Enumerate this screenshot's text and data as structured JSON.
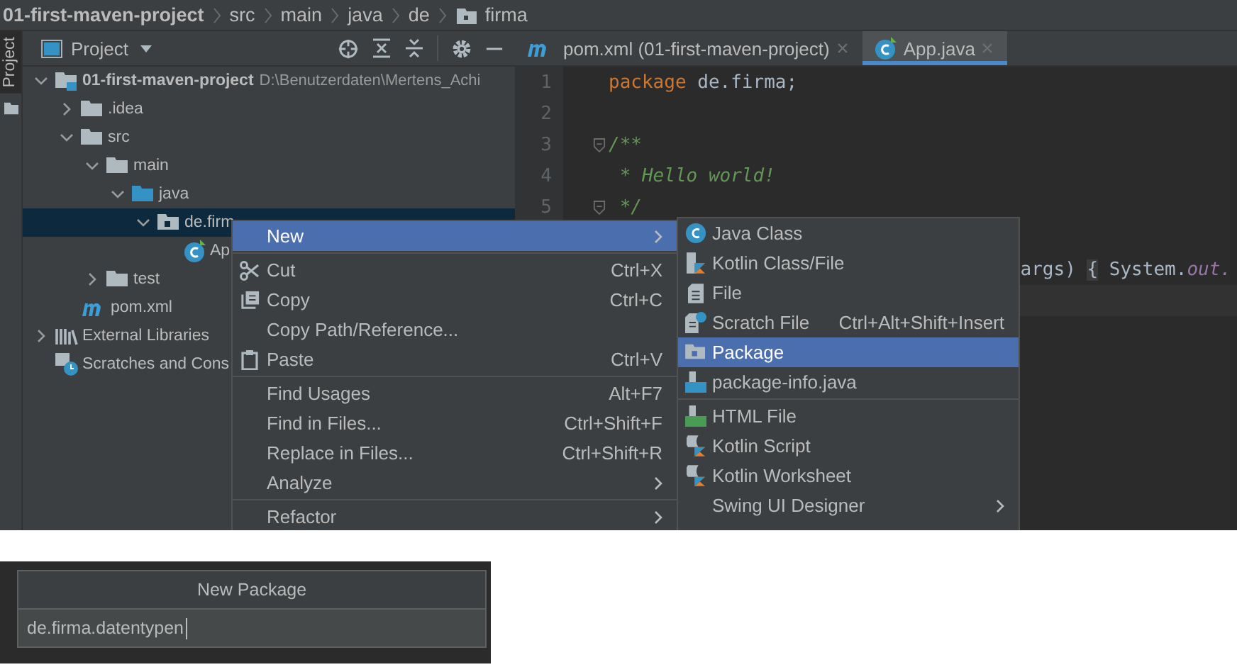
{
  "breadcrumbs": [
    {
      "label": "01-first-maven-project",
      "kind": "project"
    },
    {
      "label": "src",
      "kind": "plain"
    },
    {
      "label": "main",
      "kind": "plain"
    },
    {
      "label": "java",
      "kind": "plain"
    },
    {
      "label": "de",
      "kind": "plain"
    },
    {
      "label": "firma",
      "kind": "package"
    }
  ],
  "tool_stripe": {
    "label": "Project"
  },
  "project_panel": {
    "title": "Project"
  },
  "tree": [
    {
      "label": "01-first-maven-project",
      "path": "D:\\Benutzerdaten\\Mertens_Achi",
      "kind": "module",
      "expanded": true,
      "selected": false,
      "children": [
        {
          "label": ".idea",
          "kind": "folder",
          "expanded": false,
          "selected": false
        },
        {
          "label": "src",
          "kind": "folder",
          "expanded": true,
          "selected": false,
          "children": [
            {
              "label": "main",
              "kind": "folder",
              "expanded": true,
              "selected": false,
              "children": [
                {
                  "label": "java",
                  "kind": "source",
                  "expanded": true,
                  "selected": false,
                  "children": [
                    {
                      "label": "de.firm",
                      "kind": "package",
                      "expanded": true,
                      "selected": true,
                      "children": [
                        {
                          "label": "Ap",
                          "kind": "class",
                          "selected": false
                        }
                      ]
                    }
                  ]
                }
              ]
            },
            {
              "label": "test",
              "kind": "folder",
              "expanded": false,
              "selected": false
            }
          ]
        },
        {
          "label": "pom.xml",
          "kind": "maven",
          "selected": false
        }
      ]
    },
    {
      "label": "External Libraries",
      "kind": "libraries",
      "expanded": false,
      "selected": false
    },
    {
      "label": "Scratches and Cons",
      "kind": "scratches",
      "selected": false
    }
  ],
  "tabs": [
    {
      "label": "pom.xml (01-first-maven-project)",
      "kind": "maven",
      "selected": false
    },
    {
      "label": "App.java",
      "kind": "class",
      "selected": true
    }
  ],
  "code": [
    {
      "number": "1",
      "tokens": [
        {
          "kind": "keyword",
          "text": "package"
        },
        {
          "kind": "plain",
          "text": " de.firma;"
        }
      ]
    },
    {
      "number": "2"
    },
    {
      "number": "3",
      "fold": true,
      "tokens": [
        {
          "kind": "comment",
          "text": "/**"
        }
      ]
    },
    {
      "number": "4",
      "tokens": [
        {
          "kind": "comment",
          "text": " * Hello world!"
        }
      ]
    },
    {
      "number": "5",
      "fold": true,
      "tokens": [
        {
          "kind": "comment",
          "text": " */"
        }
      ]
    },
    {
      "partial": true,
      "tokens": [
        {
          "kind": "plain",
          "text": "args) "
        },
        {
          "kind": "brace",
          "text": "{"
        },
        {
          "kind": "plain",
          "text": " System."
        },
        {
          "kind": "field",
          "text": "out."
        }
      ]
    },
    {
      "current": true
    }
  ],
  "context_menu": {
    "items": [
      {
        "kind": "plain",
        "label": "New",
        "selected": true,
        "submenu": true
      },
      {
        "kind": "separator"
      },
      {
        "kind": "cut",
        "label": "Cut",
        "shortcut": "Ctrl+X",
        "selected": false
      },
      {
        "kind": "copy",
        "label": "Copy",
        "shortcut": "Ctrl+C",
        "selected": false
      },
      {
        "kind": "plain",
        "label": "Copy Path/Reference...",
        "selected": false
      },
      {
        "kind": "paste",
        "label": "Paste",
        "shortcut": "Ctrl+V",
        "selected": false
      },
      {
        "kind": "separator"
      },
      {
        "kind": "plain",
        "label": "Find Usages",
        "shortcut": "Alt+F7",
        "selected": false
      },
      {
        "kind": "plain",
        "label": "Find in Files...",
        "shortcut": "Ctrl+Shift+F",
        "selected": false
      },
      {
        "kind": "plain",
        "label": "Replace in Files...",
        "shortcut": "Ctrl+Shift+R",
        "selected": false
      },
      {
        "kind": "plain",
        "label": "Analyze",
        "selected": false,
        "submenu": true
      },
      {
        "kind": "separator"
      },
      {
        "kind": "plain",
        "label": "Refactor",
        "selected": false,
        "submenu": true
      }
    ]
  },
  "new_submenu": {
    "items": [
      {
        "kind": "class",
        "label": "Java Class",
        "selected": false
      },
      {
        "kind": "kotlin",
        "label": "Kotlin Class/File",
        "selected": false
      },
      {
        "kind": "file",
        "label": "File",
        "selected": false
      },
      {
        "kind": "scratch",
        "label": "Scratch File",
        "shortcut": "Ctrl+Alt+Shift+Insert",
        "selected": false
      },
      {
        "kind": "package",
        "label": "Package",
        "selected": true
      },
      {
        "kind": "javafile",
        "label": "package-info.java",
        "selected": false
      },
      {
        "kind": "separator"
      },
      {
        "kind": "html",
        "label": "HTML File",
        "selected": false
      },
      {
        "kind": "kotlinscript",
        "label": "Kotlin Script",
        "selected": false
      },
      {
        "kind": "kotlinscript",
        "label": "Kotlin Worksheet",
        "selected": false
      },
      {
        "kind": "plain",
        "label": "Swing UI Designer",
        "selected": false,
        "submenu": true
      }
    ]
  },
  "new_package_dialog": {
    "title": "New Package",
    "value": "de.firma.datentypen"
  }
}
